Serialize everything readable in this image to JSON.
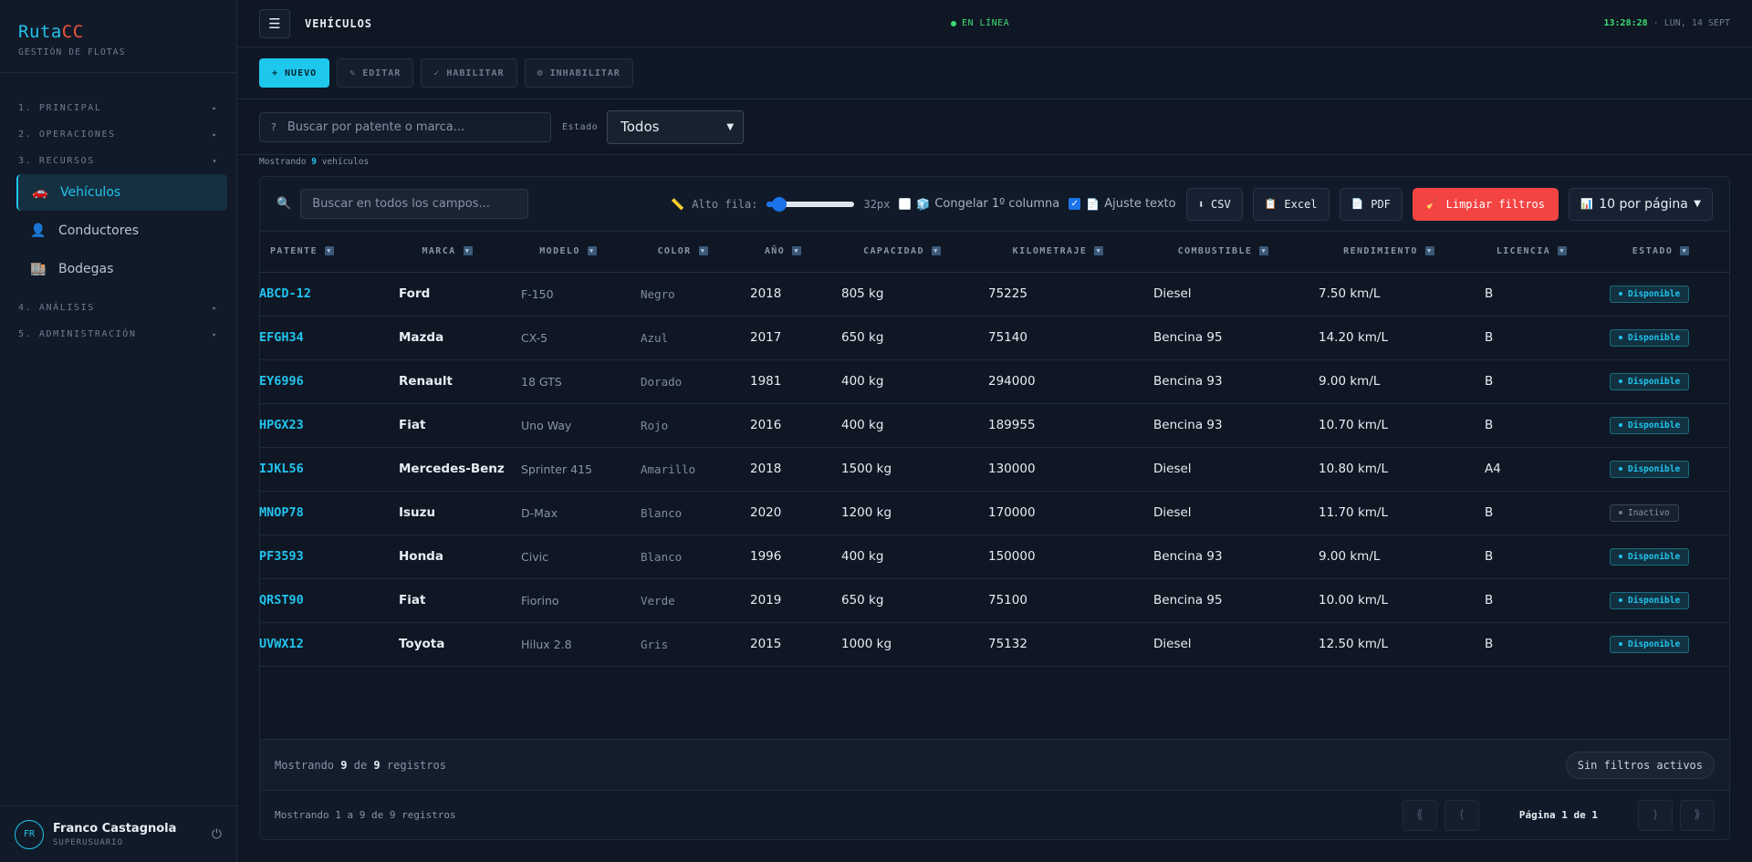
{
  "brand": {
    "name_a": "Ruta",
    "name_b": "CC",
    "subtitle": "GESTIÓN DE FLOTAS"
  },
  "sidebar": {
    "sections": [
      {
        "label": "1. PRINCIPAL",
        "chevron": "▸"
      },
      {
        "label": "2. OPERACIONES",
        "chevron": "▸"
      },
      {
        "label": "3. RECURSOS",
        "chevron": "▾"
      },
      {
        "label": "4. ANÁLISIS",
        "chevron": "▸"
      },
      {
        "label": "5. ADMINISTRACIÓN",
        "chevron": "▸"
      }
    ],
    "items": [
      {
        "label": "Vehículos",
        "icon": "🚗",
        "icon_name": "car-icon",
        "active": true
      },
      {
        "label": "Conductores",
        "icon": "👤",
        "icon_name": "person-icon",
        "active": false
      },
      {
        "label": "Bodegas",
        "icon": "🏬",
        "icon_name": "warehouse-icon",
        "active": false
      }
    ]
  },
  "user": {
    "initials": "FR",
    "name": "Franco Castagnola",
    "role": "SUPERUSUARIO"
  },
  "topbar": {
    "title": "VEHÍCULOS",
    "status": "EN LÍNEA",
    "time": "13:28:28",
    "date": "· LUN, 14 SEPT"
  },
  "actions": {
    "new": "+ NUEVO",
    "edit": "✎ EDITAR",
    "enable": "✓ HABILITAR",
    "disable": "⊘ INHABILITAR"
  },
  "filters": {
    "search_placeholder": "Buscar por patente o marca...",
    "search_icon": "?",
    "estado_label": "Estado",
    "estado_value": "Todos"
  },
  "count": {
    "prefix": "Mostrando",
    "value": "9",
    "suffix": "vehículos"
  },
  "grid": {
    "search_placeholder": "Buscar en todos los campos...",
    "row_height_label": "Alto fila:",
    "row_height_value": "32px",
    "row_height_fraction": 0.1,
    "freeze_label": "Congelar 1º columna",
    "freeze_checked": false,
    "wrap_label": "Ajuste texto",
    "wrap_checked": true,
    "csv": "⬇ CSV",
    "excel": "Excel",
    "pdf": "PDF",
    "clear": "Limpiar filtros",
    "page_size": "10 por página"
  },
  "columns": [
    "PATENTE",
    "MARCA",
    "MODELO",
    "COLOR",
    "AÑO",
    "CAPACIDAD",
    "KILOMETRAJE",
    "COMBUSTIBLE",
    "RENDIMIENTO",
    "LICENCIA",
    "ESTADO"
  ],
  "rows": [
    {
      "patente": "ABCD-12",
      "marca": "Ford",
      "modelo": "F-150",
      "color": "Negro",
      "anio": "2018",
      "capacidad": "805 kg",
      "km": "75225",
      "combustible": "Diesel",
      "rendimiento": "7.50 km/L",
      "licencia": "B",
      "estado": "Disponible"
    },
    {
      "patente": "EFGH34",
      "marca": "Mazda",
      "modelo": "CX-5",
      "color": "Azul",
      "anio": "2017",
      "capacidad": "650 kg",
      "km": "75140",
      "combustible": "Bencina 95",
      "rendimiento": "14.20 km/L",
      "licencia": "B",
      "estado": "Disponible"
    },
    {
      "patente": "EY6996",
      "marca": "Renault",
      "modelo": "18 GTS",
      "color": "Dorado",
      "anio": "1981",
      "capacidad": "400 kg",
      "km": "294000",
      "combustible": "Bencina 93",
      "rendimiento": "9.00 km/L",
      "licencia": "B",
      "estado": "Disponible"
    },
    {
      "patente": "HPGX23",
      "marca": "Fiat",
      "modelo": "Uno Way",
      "color": "Rojo",
      "anio": "2016",
      "capacidad": "400 kg",
      "km": "189955",
      "combustible": "Bencina 93",
      "rendimiento": "10.70 km/L",
      "licencia": "B",
      "estado": "Disponible"
    },
    {
      "patente": "IJKL56",
      "marca": "Mercedes-Benz",
      "modelo": "Sprinter 415",
      "color": "Amarillo",
      "anio": "2018",
      "capacidad": "1500 kg",
      "km": "130000",
      "combustible": "Diesel",
      "rendimiento": "10.80 km/L",
      "licencia": "A4",
      "estado": "Disponible"
    },
    {
      "patente": "MNOP78",
      "marca": "Isuzu",
      "modelo": "D-Max",
      "color": "Blanco",
      "anio": "2020",
      "capacidad": "1200 kg",
      "km": "170000",
      "combustible": "Diesel",
      "rendimiento": "11.70 km/L",
      "licencia": "B",
      "estado": "Inactivo"
    },
    {
      "patente": "PF3593",
      "marca": "Honda",
      "modelo": "Civic",
      "color": "Blanco",
      "anio": "1996",
      "capacidad": "400 kg",
      "km": "150000",
      "combustible": "Bencina 93",
      "rendimiento": "9.00 km/L",
      "licencia": "B",
      "estado": "Disponible"
    },
    {
      "patente": "QRST90",
      "marca": "Fiat",
      "modelo": "Fiorino",
      "color": "Verde",
      "anio": "2019",
      "capacidad": "650 kg",
      "km": "75100",
      "combustible": "Bencina 95",
      "rendimiento": "10.00 km/L",
      "licencia": "B",
      "estado": "Disponible"
    },
    {
      "patente": "UVWX12",
      "marca": "Toyota",
      "modelo": "Hilux 2.8",
      "color": "Gris",
      "anio": "2015",
      "capacidad": "1000 kg",
      "km": "75132",
      "combustible": "Diesel",
      "rendimiento": "12.50 km/L",
      "licencia": "B",
      "estado": "Disponible"
    }
  ],
  "summary": {
    "prefix": "Mostrando",
    "shown": "9",
    "mid": "de",
    "total": "9",
    "suffix": "registros",
    "filters_pill": "Sin filtros activos"
  },
  "pager": {
    "text": "Mostrando 1 a 9 de 9 registros",
    "first": "⟪",
    "prev": "⟨",
    "next": "⟩",
    "last": "⟫",
    "label_prefix": "Página",
    "page": "1",
    "label_mid": "de",
    "pages": "1"
  },
  "colors": {
    "accent": "#22c3ee",
    "danger": "#f44343",
    "online": "#3ddc72",
    "brand_b": "#f0553f"
  }
}
